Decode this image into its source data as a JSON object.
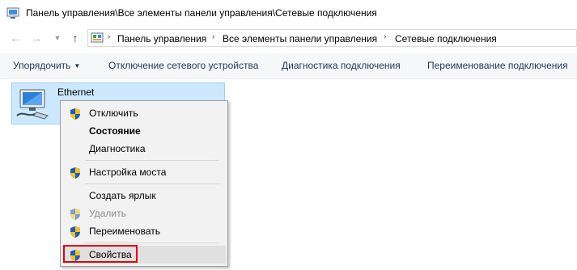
{
  "window": {
    "title": "Панель управления\\Все элементы панели управления\\Сетевые подключения"
  },
  "address": {
    "crumbs": [
      "Панель управления",
      "Все элементы панели управления",
      "Сетевые подключения"
    ]
  },
  "toolbar": {
    "organize": "Упорядочить",
    "disable": "Отключение сетевого устройства",
    "diagnose": "Диагностика подключения",
    "rename": "Переименование подключения"
  },
  "connection": {
    "name": "Ethernet"
  },
  "context_menu": {
    "items": [
      {
        "label": "Отключить",
        "shield": true,
        "bold": false,
        "disabled": false
      },
      {
        "label": "Состояние",
        "shield": false,
        "bold": true,
        "disabled": false
      },
      {
        "label": "Диагностика",
        "shield": false,
        "bold": false,
        "disabled": false
      },
      {
        "label": "Настройка моста",
        "shield": true,
        "bold": false,
        "disabled": false
      },
      {
        "label": "Создать ярлык",
        "shield": false,
        "bold": false,
        "disabled": false
      },
      {
        "label": "Удалить",
        "shield": true,
        "bold": false,
        "disabled": true
      },
      {
        "label": "Переименовать",
        "shield": true,
        "bold": false,
        "disabled": false
      },
      {
        "label": "Свойства",
        "shield": true,
        "bold": false,
        "disabled": false,
        "highlighted": true
      }
    ]
  },
  "colors": {
    "selection_fill": "#cce8ff",
    "selection_border": "#99d1ff",
    "highlight_box": "#e8000b",
    "command_text": "#1e395b"
  }
}
